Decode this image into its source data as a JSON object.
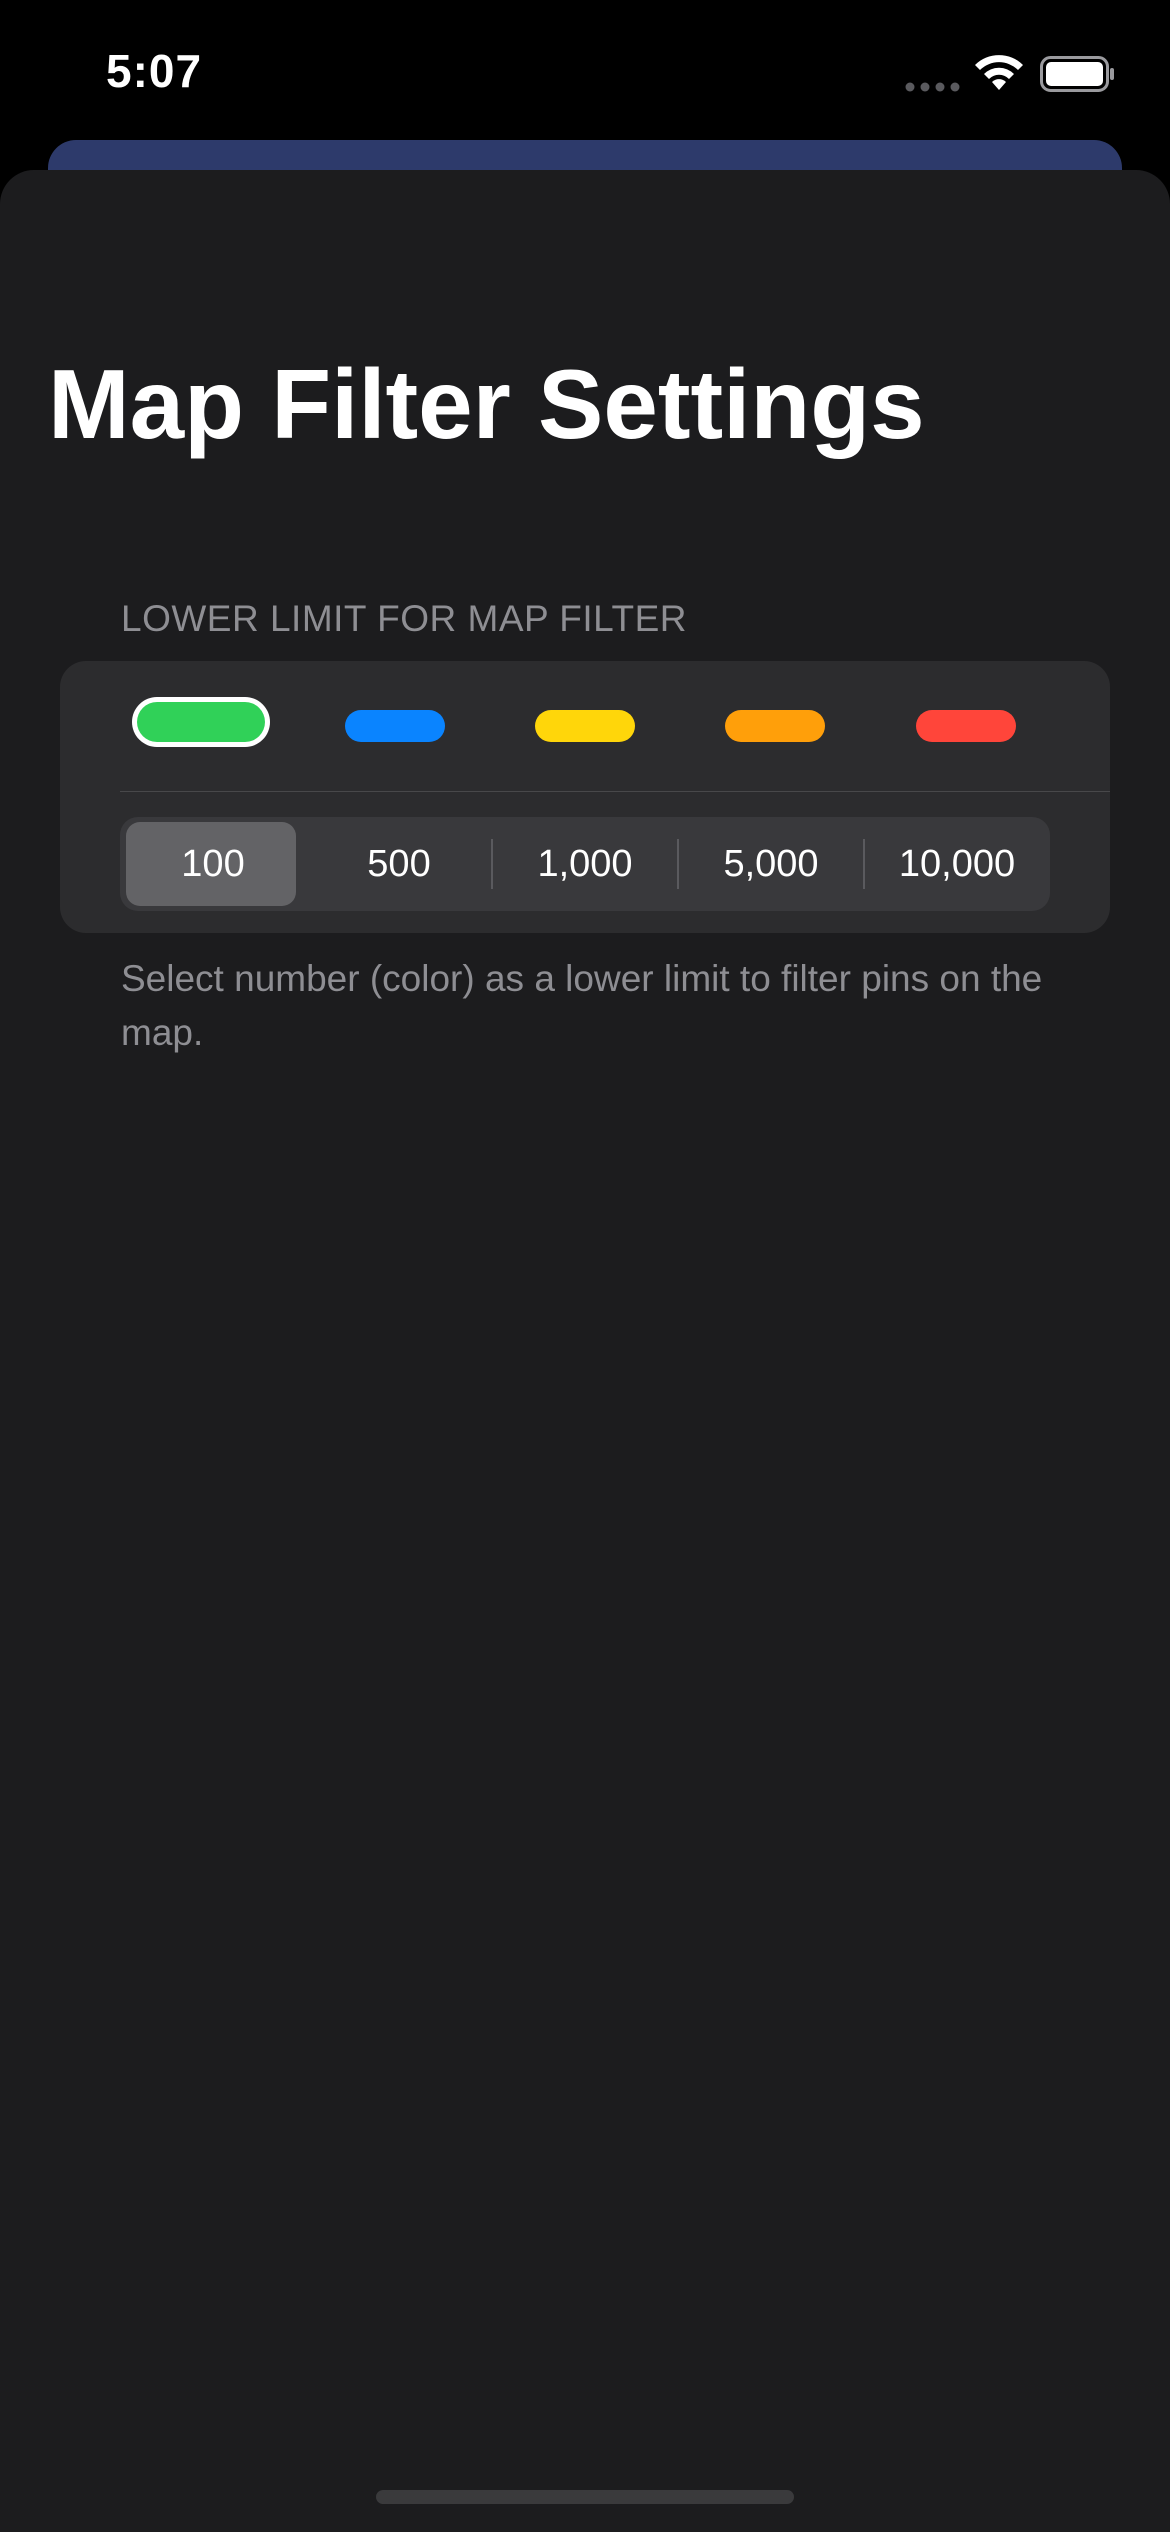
{
  "status_bar": {
    "time": "5:07"
  },
  "page": {
    "title": "Map Filter Settings"
  },
  "filter_section": {
    "header": "LOWER LIMIT FOR MAP FILTER",
    "swatches": [
      {
        "color": "#30d158",
        "selected": true
      },
      {
        "color": "#0a84ff",
        "selected": false
      },
      {
        "color": "#ffd60a",
        "selected": false
      },
      {
        "color": "#ff9f0a",
        "selected": false
      },
      {
        "color": "#ff453a",
        "selected": false
      }
    ],
    "segments": [
      "100",
      "500",
      "1,000",
      "5,000",
      "10,000"
    ],
    "selected_segment": "100",
    "footer": "Select number (color) as a lower limit to filter pins on the map."
  }
}
